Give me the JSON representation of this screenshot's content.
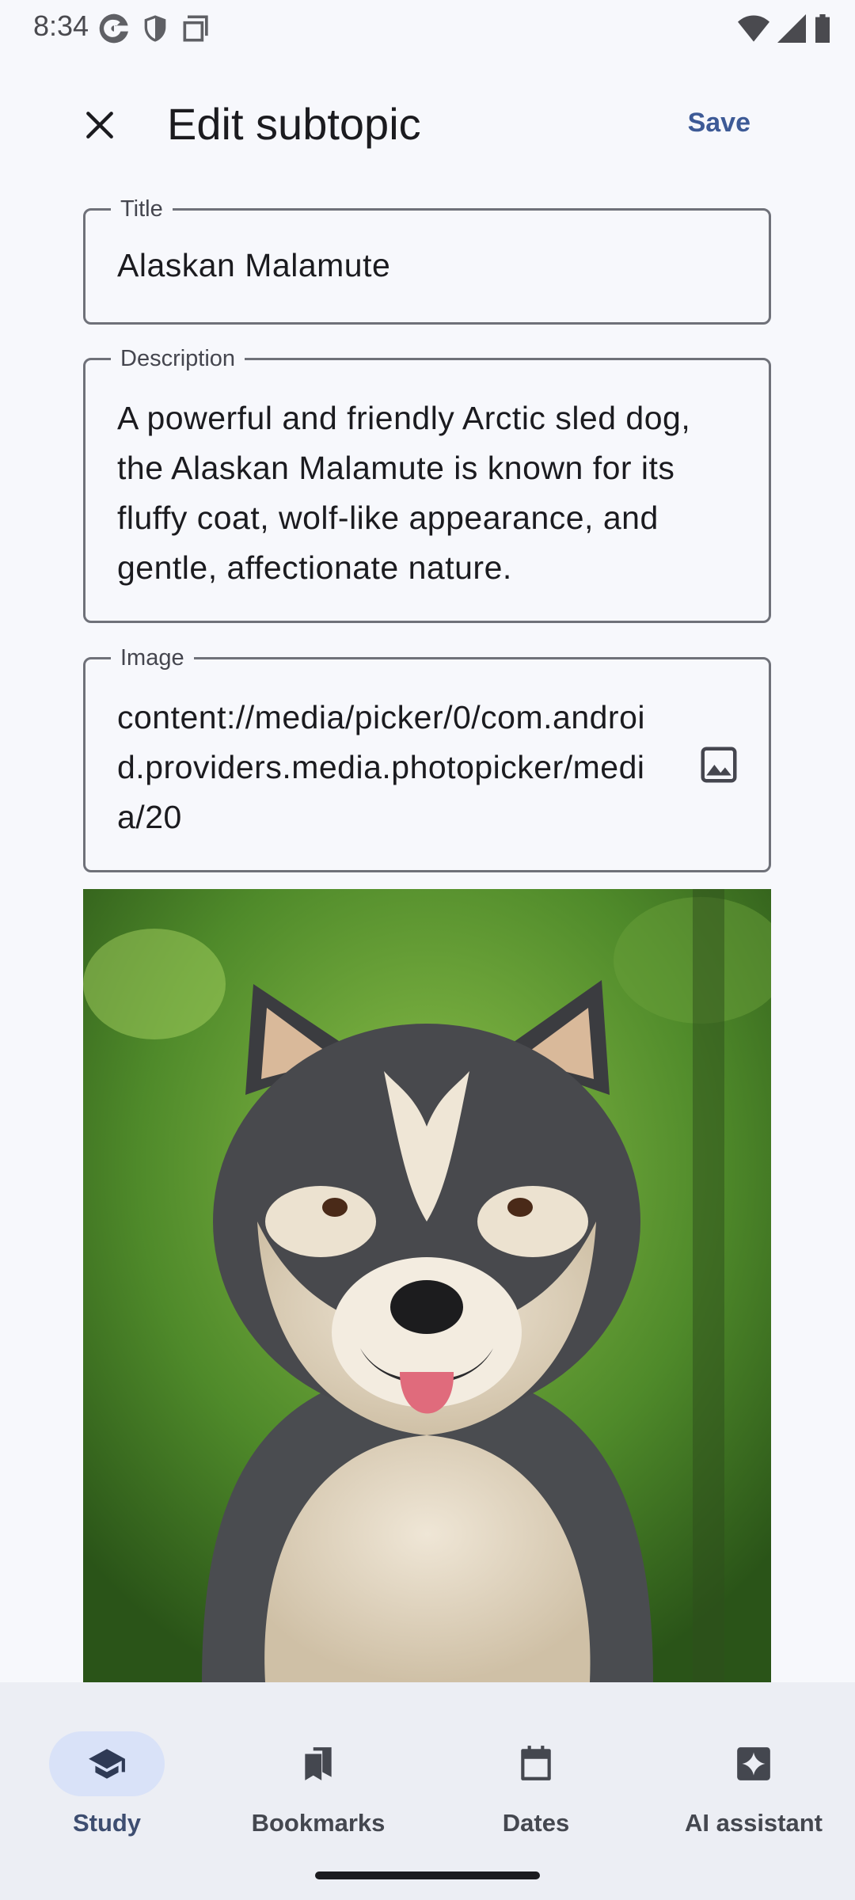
{
  "status_bar": {
    "time": "8:34",
    "left_icons": [
      "google-icon",
      "shield-icon",
      "screen-icon"
    ],
    "right_icons": [
      "wifi-icon",
      "signal-icon",
      "battery-icon"
    ]
  },
  "top_bar": {
    "title": "Edit subtopic",
    "save_label": "Save",
    "close_icon": "close-icon"
  },
  "form": {
    "title_label": "Title",
    "title_value": "Alaskan Malamute",
    "description_label": "Description",
    "description_value": "A powerful and friendly Arctic sled dog, the Alaskan Malamute is known for its fluffy coat, wolf-like appearance, and gentle, affectionate nature.",
    "image_label": "Image",
    "image_value": "content://media/picker/0/com.android.providers.media.photopicker/media/20",
    "image_icon": "image-icon"
  },
  "bottom_nav": {
    "items": [
      {
        "label": "Study",
        "icon": "school-icon",
        "active": true
      },
      {
        "label": "Bookmarks",
        "icon": "bookmarks-icon",
        "active": false
      },
      {
        "label": "Dates",
        "icon": "calendar-icon",
        "active": false
      },
      {
        "label": "AI assistant",
        "icon": "sparkle-icon",
        "active": false
      }
    ]
  },
  "colors": {
    "background": "#f7f8fc",
    "accent": "#3d5a96",
    "nav_background": "#eceef4",
    "active_pill": "#d9e2f8"
  }
}
